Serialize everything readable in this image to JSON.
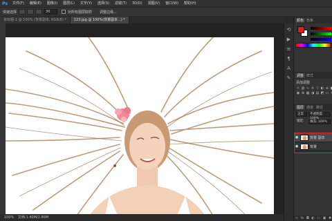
{
  "app": {
    "logo": "Ps"
  },
  "menu": [
    "文件(F)",
    "编辑(E)",
    "图像(I)",
    "图层(L)",
    "文字(Y)",
    "选择(S)",
    "滤镜(T)",
    "3D(D)",
    "视图(V)",
    "窗口(W)",
    "帮助(H)"
  ],
  "options": {
    "tool_label": "快速选择",
    "size_value": "30",
    "sample_label": "对所有图层取样",
    "refine_label": "调整边缘..."
  },
  "tabs": [
    {
      "label": "未标题-1 @ 100% (背景副本, RGB/8) *",
      "active": false
    },
    {
      "label": "123.jpg @ 100%(背景副本...) *",
      "active": true
    }
  ],
  "status": {
    "zoom": "100%",
    "doc": "文档:1.40M/2.80M"
  },
  "dock_icons": [
    "history-icon",
    "actions-icon",
    "properties-icon",
    "paragraph-icon",
    "character-icon",
    "brush-icon"
  ],
  "panels": {
    "color_tabs": [
      "颜色",
      "色板"
    ],
    "adjust_title": "添加调整",
    "adjust_tabs": [
      "调整",
      "样式"
    ],
    "adjust_icons": [
      "brightness",
      "levels",
      "curves",
      "exposure",
      "vibrance",
      "hue",
      "balance",
      "bw",
      "photo",
      "mixer",
      "lookup",
      "invert",
      "posterize",
      "threshold",
      "gradient",
      "selective"
    ],
    "layers_tabs": [
      "图层",
      "通道",
      "路径"
    ],
    "blend_mode": "正常",
    "opacity_label": "不透明度: 100%",
    "lock_label": "锁定:",
    "fill_label": "填充: 100%",
    "layers": [
      {
        "name": "背景 副本",
        "visible": true,
        "selected": true
      },
      {
        "name": "背景",
        "visible": true,
        "selected": false
      }
    ]
  },
  "colors": {
    "foreground": "#e31b1b",
    "background": "#ffffff",
    "highlight": "#e02a2a"
  }
}
